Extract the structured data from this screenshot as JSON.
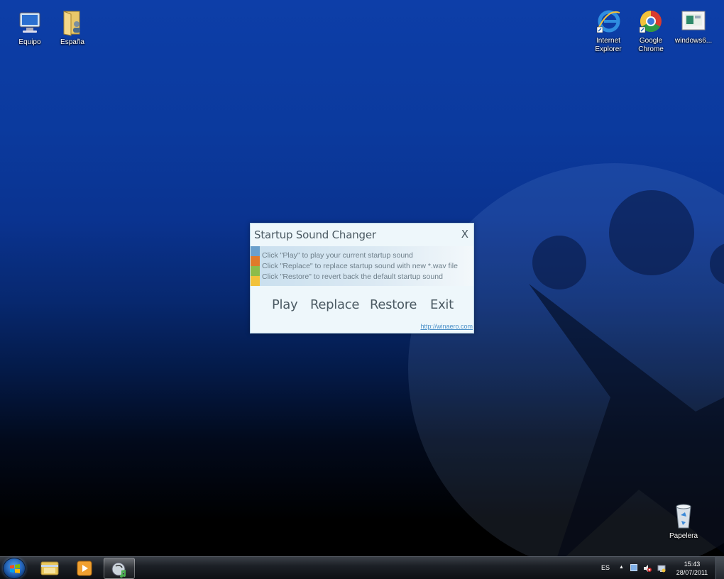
{
  "desktop": {
    "icons_left": [
      {
        "label": "Equipo"
      },
      {
        "label": "España"
      }
    ],
    "icons_right": [
      {
        "label": "Internet Explorer"
      },
      {
        "label": "Google Chrome"
      },
      {
        "label": "windows6..."
      }
    ],
    "recycle_bin": {
      "label": "Papelera"
    }
  },
  "dialog": {
    "title": "Startup Sound Changer",
    "close_label": "X",
    "instructions": [
      "Click \"Play\" to play your current startup sound",
      "Click \"Replace\" to replace startup sound with new *.wav file",
      "Click \"Restore\" to revert back the default startup sound"
    ],
    "stripe_colors": [
      "#6aa0cc",
      "#e07a2a",
      "#8cbc4a",
      "#f2c23a"
    ],
    "buttons": {
      "play": "Play",
      "replace": "Replace",
      "restore": "Restore",
      "exit": "Exit"
    },
    "link": "http://winaero.com"
  },
  "taskbar": {
    "language": "ES",
    "tray_arrow": "▲",
    "time": "15:43",
    "date": "28/07/2011"
  }
}
